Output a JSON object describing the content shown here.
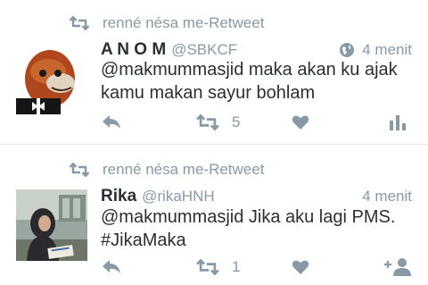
{
  "tweets": [
    {
      "retweet_text": "renné nésa me-Retweet",
      "name": "A N O M",
      "handle": "@SBKCF",
      "time": "4 menit",
      "text": "@makmummasjid maka akan ku ajak kamu makan sayur bohlam",
      "retweet_count": "5",
      "icons": [
        "retweet-icon",
        "globe-icon",
        "reply-icon",
        "retweet-icon",
        "like-icon",
        "analytics-icon"
      ]
    },
    {
      "retweet_text": "renné nésa me-Retweet",
      "name": "Rika",
      "handle": "@rikaHNH",
      "time": "4 menit",
      "text": "@makmummasjid Jika aku lagi PMS. #JikaMaka",
      "retweet_count": "1",
      "icons": [
        "retweet-icon",
        "reply-icon",
        "retweet-icon",
        "like-icon",
        "follow-icon"
      ]
    }
  ],
  "colors": {
    "muted": "#8899a6",
    "text": "#292f33",
    "divider": "#e1e8ed"
  }
}
